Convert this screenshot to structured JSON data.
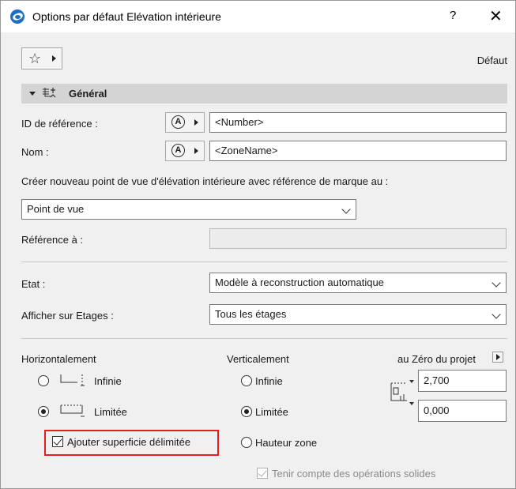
{
  "window": {
    "title": "Options par défaut Elévation intérieure",
    "help_label": "?",
    "close_label": "✕"
  },
  "toolbar": {
    "default_label": "Défaut"
  },
  "section": {
    "title": "Général"
  },
  "fields": {
    "ref_id_label": "ID de référence :",
    "ref_id_value": "<Number>",
    "name_label": "Nom :",
    "name_value": "<ZoneName>",
    "create_label": "Créer nouveau point de vue d'élévation intérieure avec référence de marque au :",
    "create_value": "Point de vue",
    "ref_to_label": "Référence à :",
    "ref_to_value": "",
    "state_label": "Etat :",
    "state_value": "Modèle à reconstruction automatique",
    "show_on_label": "Afficher sur Etages :",
    "show_on_value": "Tous les étages"
  },
  "horizontal": {
    "label": "Horizontalement",
    "options": [
      "Infinie",
      "Limitée"
    ],
    "selected": "Limitée",
    "add_area_label": "Ajouter superficie délimitée",
    "add_area_checked": true
  },
  "vertical": {
    "label": "Verticalement",
    "options": [
      "Infinie",
      "Limitée",
      "Hauteur zone"
    ],
    "selected": "Limitée",
    "reference_label": "au Zéro du projet",
    "top_value": "2,700",
    "bottom_value": "0,000",
    "solid_ops_label": "Tenir compte des opérations solides",
    "solid_ops_checked": true
  },
  "icons": {
    "app": "archicad-icon",
    "favorites": "star-icon",
    "general": "general-settings-icon",
    "marker": "marker-symbol-icon",
    "height": "height-dimension-icon"
  }
}
